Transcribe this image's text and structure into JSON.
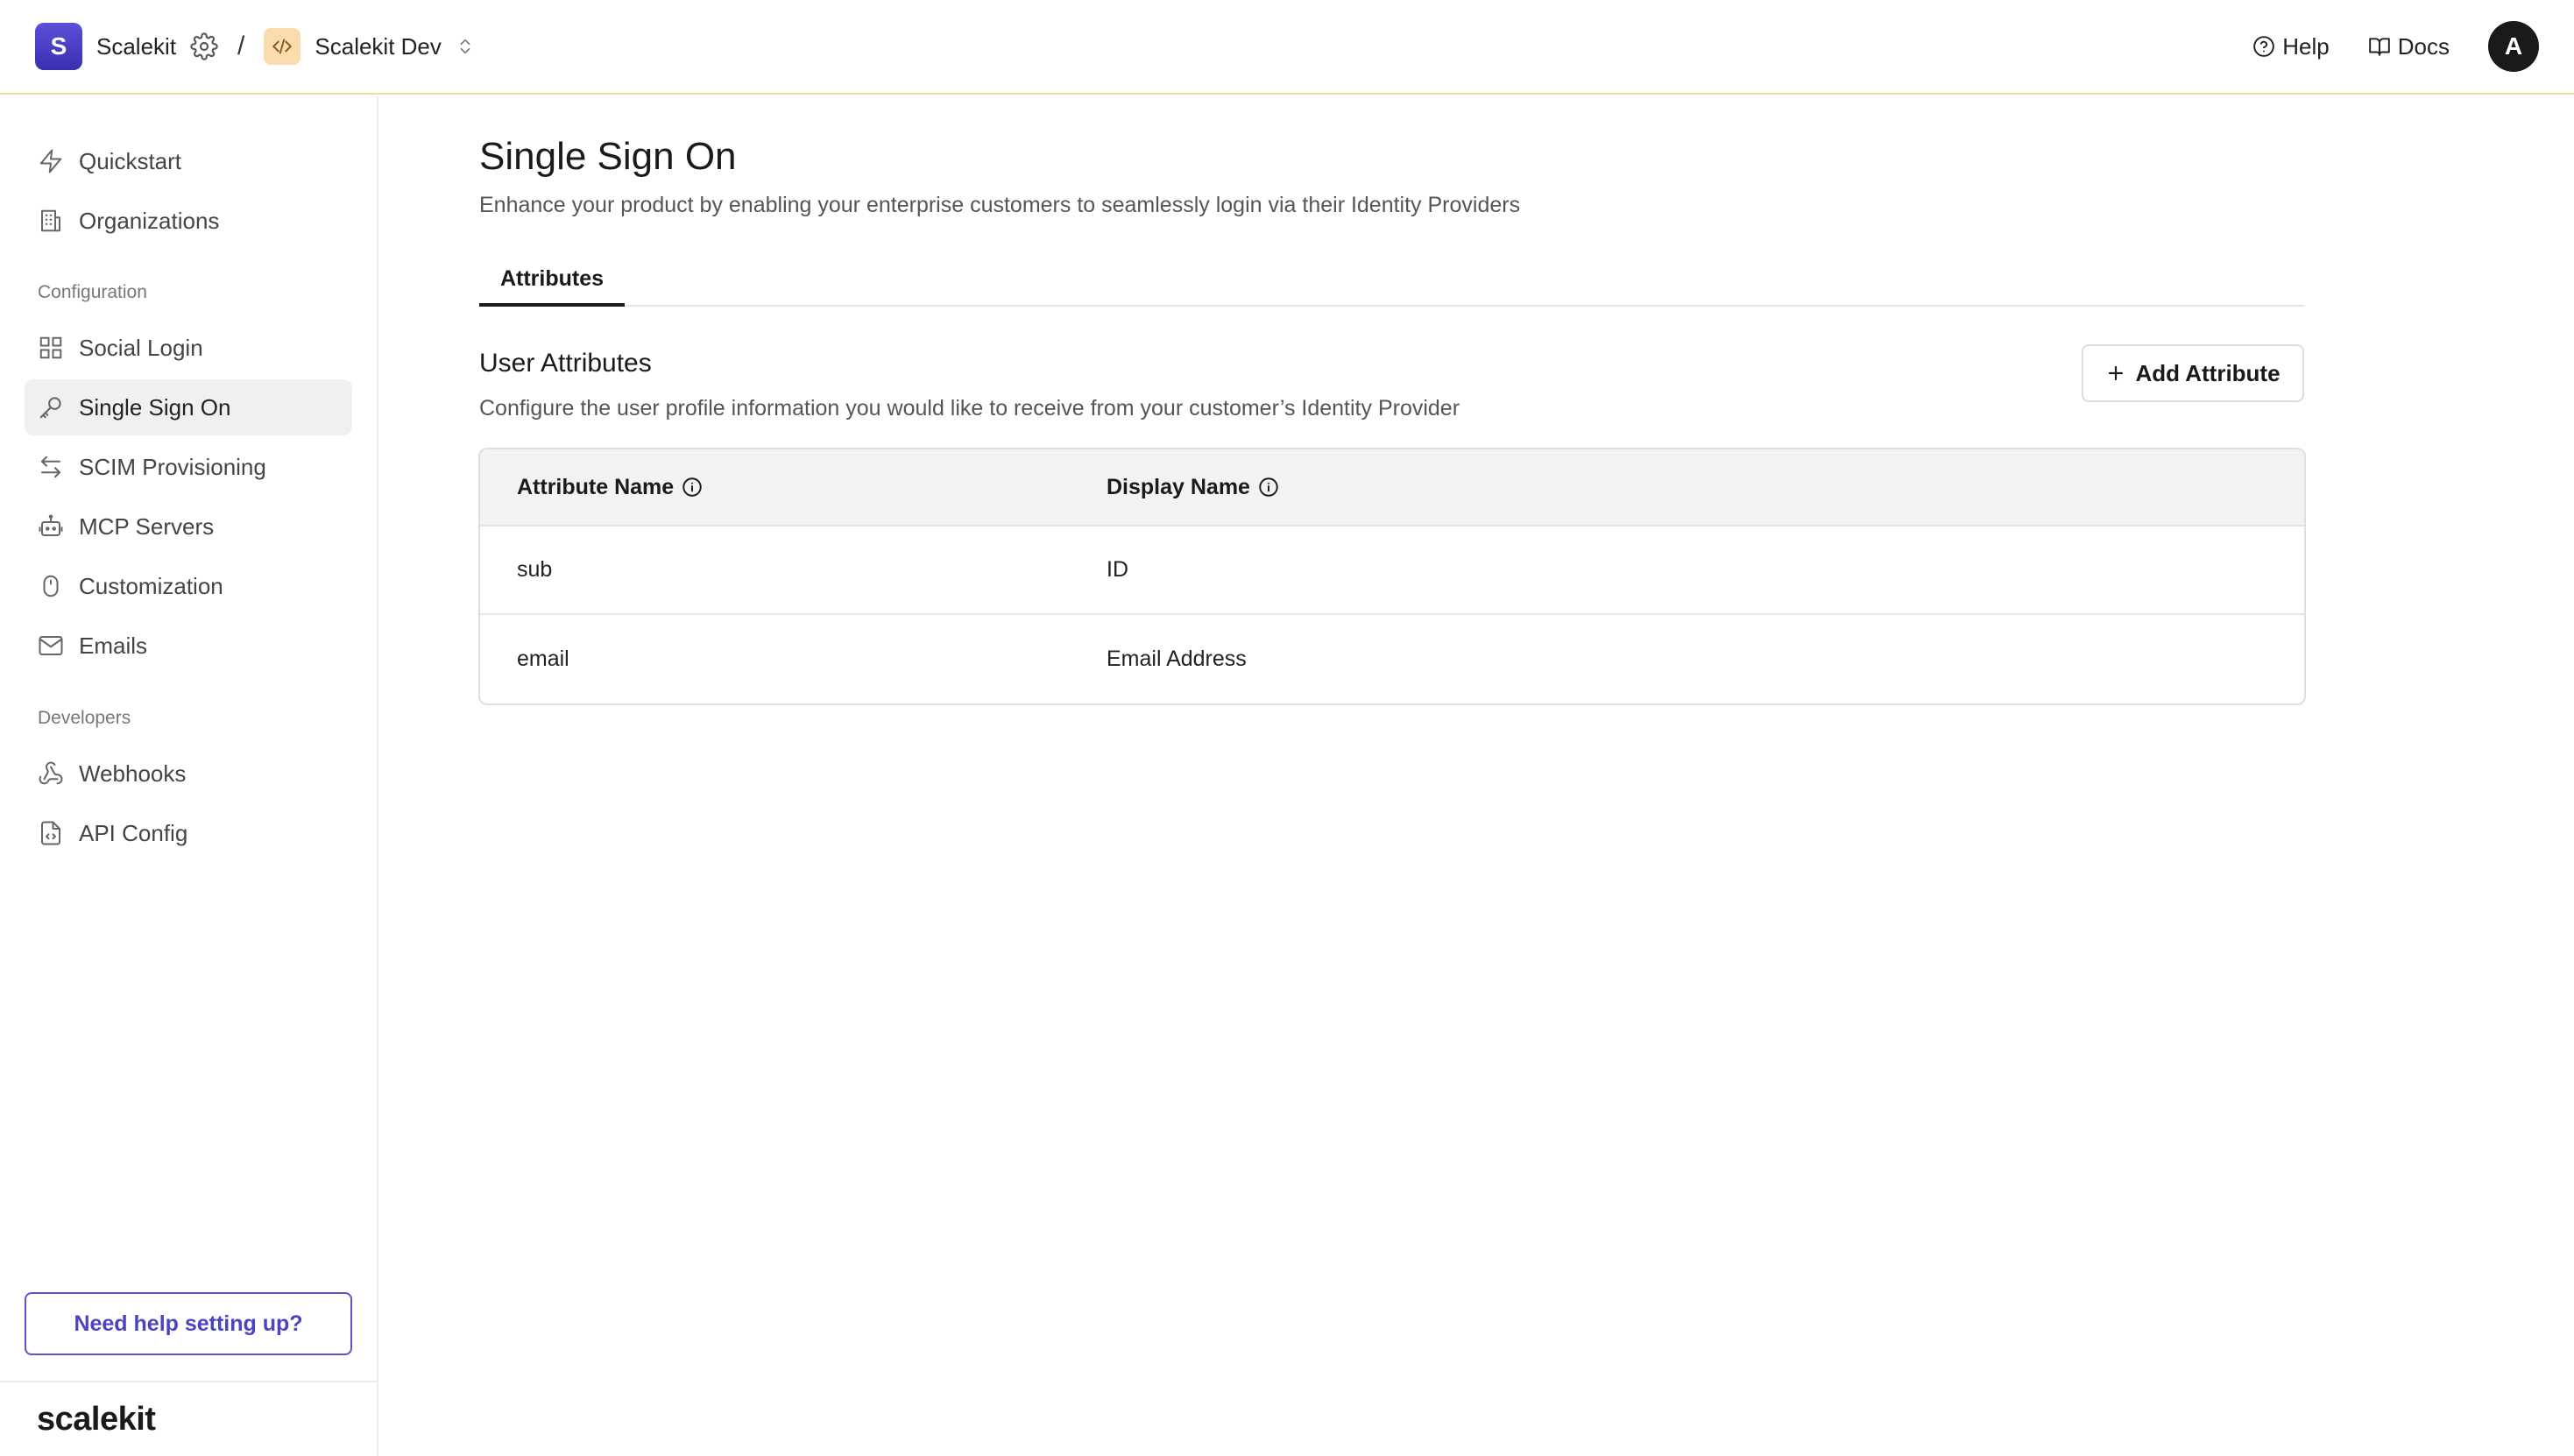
{
  "header": {
    "workspace_initial": "S",
    "workspace_name": "Scalekit",
    "separator": "/",
    "environment_name": "Scalekit Dev",
    "help_label": "Help",
    "docs_label": "Docs",
    "avatar_initial": "A"
  },
  "sidebar": {
    "items_top": [
      {
        "label": "Quickstart",
        "icon": "bolt-icon"
      },
      {
        "label": "Organizations",
        "icon": "building-icon"
      }
    ],
    "section_configuration": "Configuration",
    "items_config": [
      {
        "label": "Social Login",
        "icon": "grid-icon"
      },
      {
        "label": "Single Sign On",
        "icon": "key-icon",
        "active": true
      },
      {
        "label": "SCIM Provisioning",
        "icon": "arrows-swap-icon"
      },
      {
        "label": "MCP Servers",
        "icon": "robot-icon"
      },
      {
        "label": "Customization",
        "icon": "mouse-icon"
      },
      {
        "label": "Emails",
        "icon": "mail-icon"
      }
    ],
    "section_developers": "Developers",
    "items_dev": [
      {
        "label": "Webhooks",
        "icon": "webhook-icon"
      },
      {
        "label": "API Config",
        "icon": "file-code-icon"
      }
    ],
    "help_button_label": "Need help setting up?",
    "brand_wordmark": "scalekit"
  },
  "main": {
    "title": "Single Sign On",
    "subtitle": "Enhance your product by enabling your enterprise customers to seamlessly login via their Identity Providers",
    "tabs": [
      {
        "label": "Attributes",
        "active": true
      }
    ],
    "section_title": "User Attributes",
    "section_subtitle": "Configure the user profile information you would like to receive from your customer’s Identity Provider",
    "add_button_label": "Add Attribute",
    "table": {
      "columns": [
        "Attribute Name",
        "Display Name"
      ],
      "rows": [
        [
          "sub",
          "ID"
        ],
        [
          "email",
          "Email Address"
        ]
      ]
    }
  },
  "colors": {
    "brand": "#4a44c0",
    "header_border": "#f0dca0",
    "env_badge": "#fbdcae",
    "active_nav_bg": "#f0f0f0"
  }
}
